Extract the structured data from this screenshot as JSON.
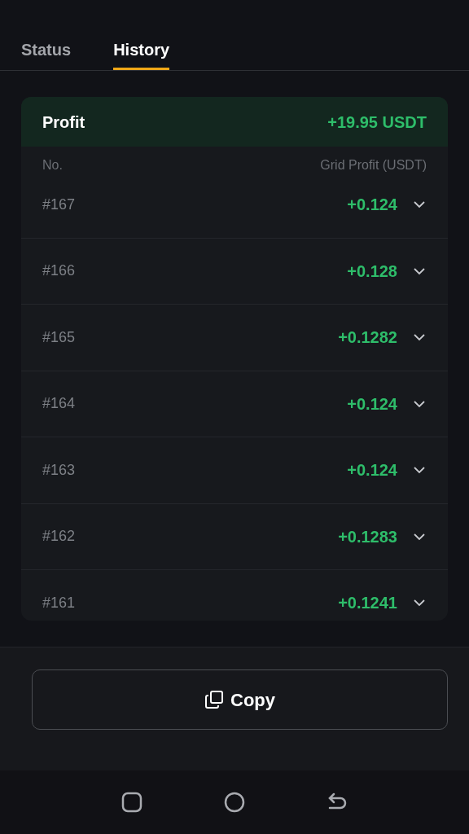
{
  "tabs": [
    {
      "label": "Status",
      "selected": false
    },
    {
      "label": "History",
      "selected": true
    }
  ],
  "profit": {
    "label": "Profit",
    "value": "+19.95 USDT"
  },
  "columns": [
    "No.",
    "Grid Profit (USDT)"
  ],
  "rows": [
    {
      "no": "#167",
      "profit": "+0.124",
      "expanded": false
    },
    {
      "no": "#166",
      "profit": "+0.128",
      "expanded": false
    },
    {
      "no": "#165",
      "profit": "+0.1282",
      "expanded": false
    },
    {
      "no": "#164",
      "profit": "+0.124",
      "expanded": false
    },
    {
      "no": "#163",
      "profit": "+0.124",
      "expanded": false
    },
    {
      "no": "#162",
      "profit": "+0.1283",
      "expanded": false
    },
    {
      "no": "#161",
      "profit": "+0.1241",
      "expanded": false
    }
  ],
  "copy_button": {
    "label": "Copy"
  }
}
